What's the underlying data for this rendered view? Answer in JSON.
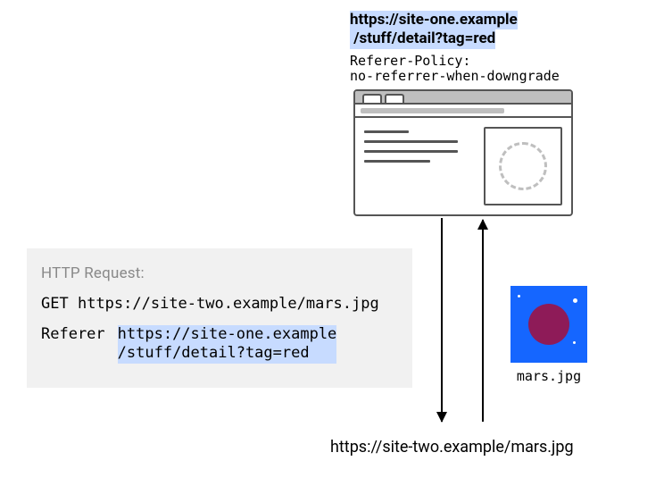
{
  "page": {
    "url_line1": "https://site-one.example",
    "url_line2": "/stuff/detail?tag=red",
    "policy_label": "Referer-Policy:",
    "policy_value": "no-referrer-when-downgrade"
  },
  "request": {
    "caption": "HTTP Request:",
    "method": "GET",
    "target": "https://site-two.example/mars.jpg",
    "header_name": "Referer",
    "referer_line1": "https://site-one.example",
    "referer_line2": "/stuff/detail?tag=red"
  },
  "image": {
    "filename": "mars.jpg",
    "url": "https://site-two.example/mars.jpg"
  }
}
